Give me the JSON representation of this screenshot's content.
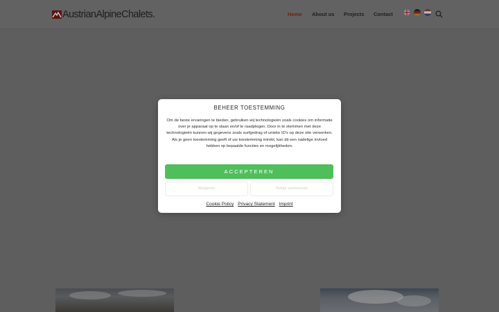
{
  "header": {
    "logo_text": "AustrianAlpineChalets.",
    "nav": [
      {
        "label": "Home",
        "active": true
      },
      {
        "label": "About us",
        "active": false
      },
      {
        "label": "Projects",
        "active": false
      },
      {
        "label": "Contact",
        "active": false
      }
    ],
    "languages": [
      "English",
      "Deutsch",
      "Nederlands"
    ]
  },
  "consent": {
    "title": "BEHEER TOESTEMMING",
    "body": "Om de beste ervaringen te bieden, gebruiken wij technologieën zoals cookies om informatie over je apparaat op te slaan en/of te raadplegen. Door in te stemmen met deze technologieën kunnen wij gegevens zoals surfgedrag of unieke ID's op deze site verwerken. Als je geen toestemming geeft of uw toestemming intrekt, kan dit een nadelige invloed hebben op bepaalde functies en mogelijkheden.",
    "accept_label": "ACCEPTEREN",
    "deny_label": "Weigeren",
    "prefs_label": "Bekijk voorkeuren",
    "links": [
      "Cookie Policy",
      "Privacy Statement",
      "Imprint"
    ]
  },
  "colors": {
    "accent_nav": "#7a1a12",
    "accept_button": "#4fbf5b",
    "overlay": "#5e5e5e"
  }
}
